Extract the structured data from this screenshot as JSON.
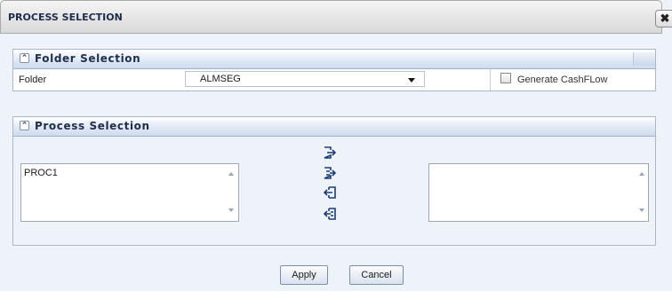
{
  "dialog": {
    "title": "PROCESS SELECTION",
    "close_icon": "close-icon"
  },
  "folder_section": {
    "title": "Folder Selection",
    "folder_label": "Folder",
    "folder_value": "ALMSEG",
    "generate_cashflow_label": "Generate CashFLow",
    "generate_cashflow_checked": false
  },
  "process_section": {
    "title": "Process Selection",
    "available_processes": [
      "PROC1"
    ],
    "selected_processes": [],
    "move_buttons": [
      "move-selected-right-icon",
      "move-all-right-icon",
      "move-selected-left-icon",
      "move-all-left-icon"
    ]
  },
  "footer": {
    "apply_label": "Apply",
    "cancel_label": "Cancel"
  }
}
